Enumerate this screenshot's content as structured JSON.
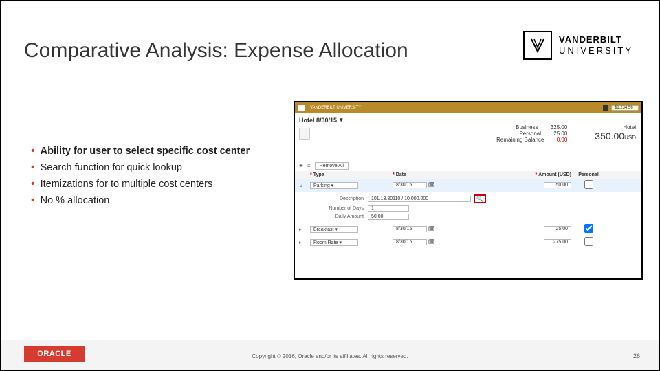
{
  "title": "Comparative Analysis: Expense Allocation",
  "vanderbilt": {
    "line1": "VANDERBILT",
    "line2": "UNIVERSITY"
  },
  "bullets": [
    {
      "text": "Ability for user to select specific cost center",
      "bold": true
    },
    {
      "text": "Search function for quick lookup",
      "bold": false
    },
    {
      "text": "Itemizations for to multiple cost centers",
      "bold": false
    },
    {
      "text": "No % allocation",
      "bold": false
    }
  ],
  "shot": {
    "topBrand": "VANDERBILT UNIVERSITY",
    "balancePill": "$1,234.56 :",
    "hotelTitle": "Hotel 8/30/15",
    "totals": {
      "businessLabel": "Business",
      "businessVal": "325.00",
      "personalLabel": "Personal",
      "personalVal": "25.00",
      "remainingLabel": "Remaining Balance",
      "remainingVal": "0.00",
      "hotelLabel": "Hotel",
      "hotelBig": "350.00",
      "hotelCur": "USD"
    },
    "toolbar": {
      "plus": "+",
      "list": "≡",
      "removeAll": "Remove All"
    },
    "headers": {
      "type": "Type",
      "date": "Date",
      "amount": "Amount (USD)",
      "personal": "Personal"
    },
    "rows": [
      {
        "type": "Parking",
        "date": "8/30/15",
        "amount": "50.00",
        "personal": false,
        "highlight": true
      },
      {
        "type": "Breakfast",
        "date": "8/30/15",
        "amount": "25.00",
        "personal": true,
        "highlight": false
      },
      {
        "type": "Room Rate",
        "date": "8/30/15",
        "amount": "275.00",
        "personal": false,
        "highlight": false
      }
    ],
    "detail": {
      "descriptionLabel": "Description",
      "descriptionValue": "101.13.30110 / 10.000.000",
      "numDaysLabel": "Number of Days",
      "numDaysVal": "1",
      "dailyAmtLabel": "Daily Amount",
      "dailyAmtVal": "50.00"
    }
  },
  "footer": {
    "oracle": "ORACLE",
    "copyright": "Copyright © 2016, Oracle and/or its affiliates. All rights reserved.",
    "page": "26"
  }
}
